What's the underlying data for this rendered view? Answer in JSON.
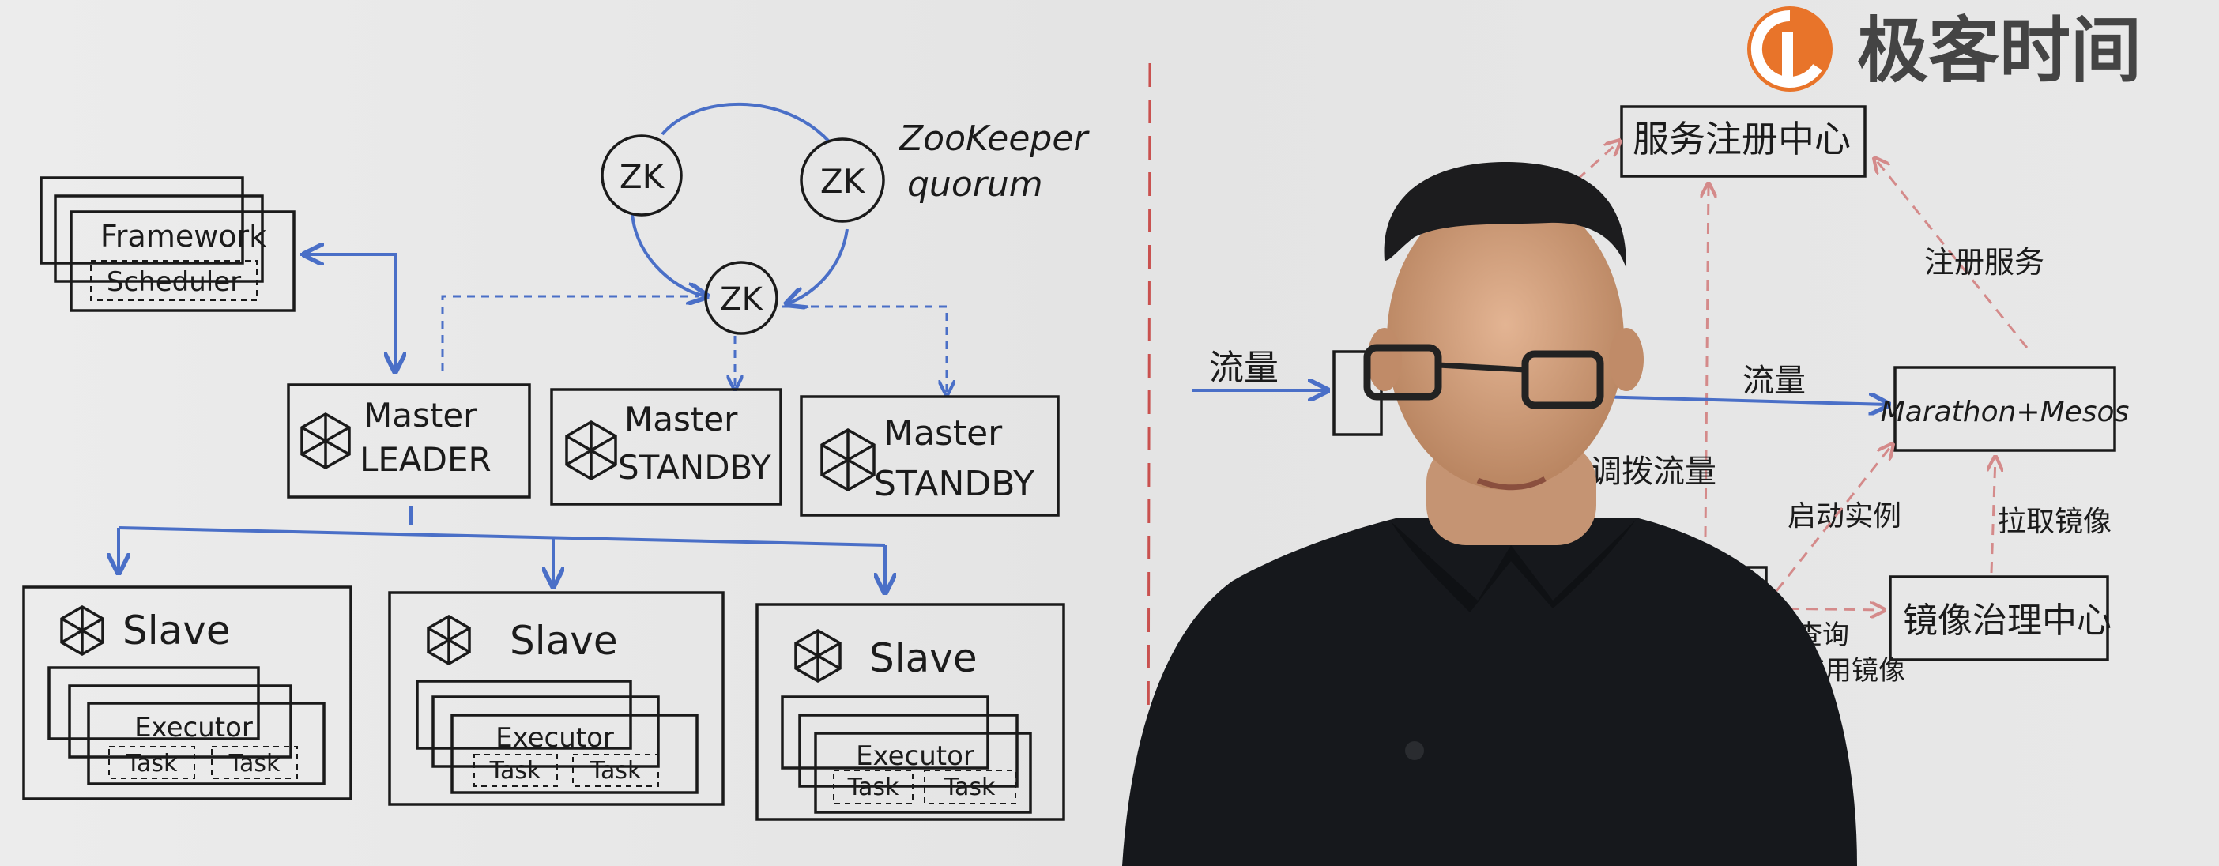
{
  "logo": {
    "text": "极客时间",
    "color": "#e8742a"
  },
  "left": {
    "zk_nodes": [
      "ZK",
      "ZK",
      "ZK"
    ],
    "zookeeper_label": [
      "ZooKeeper",
      "quorum"
    ],
    "framework": {
      "title": "Framework",
      "scheduler": "Scheduler"
    },
    "masters": [
      {
        "line1": "Master",
        "line2": "LEADER"
      },
      {
        "line1": "Master",
        "line2": "STANDBY"
      },
      {
        "line1": "Master",
        "line2": "STANDBY"
      }
    ],
    "slaves": [
      {
        "title": "Slave",
        "executor": "Executor",
        "tasks": [
          "Task",
          "Task"
        ]
      },
      {
        "title": "Slave",
        "executor": "Executor",
        "tasks": [
          "Task",
          "Task"
        ]
      },
      {
        "title": "Slave",
        "executor": "Executor",
        "tasks": [
          "Task",
          "Task"
        ]
      }
    ]
  },
  "right": {
    "registry": "服务注册中心",
    "register_service": "注册服务",
    "traffic_in": "流量",
    "traffic_mid": "流量",
    "marathon": "Marathon+Mesos",
    "dispatch_traffic": "调拨流量",
    "start_instance": "启动实例",
    "pull_image": "拉取镜像",
    "image_center": "镜像治理中心",
    "query_image": [
      "查询",
      "应用镜像"
    ]
  },
  "colors": {
    "ink": "#1a1a1a",
    "blue_marker": "#4a6fc7",
    "red_marker": "#c9514f",
    "shirt": "#16181c"
  }
}
